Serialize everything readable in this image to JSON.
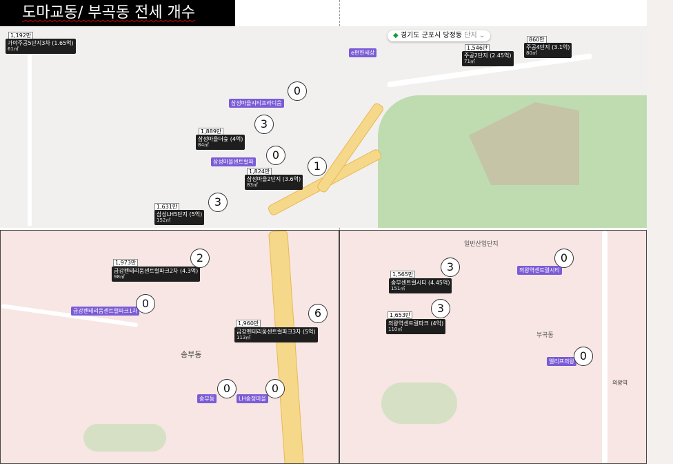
{
  "title": "도마교동/ 부곡동 전세 개수",
  "region_chip": {
    "icon": "location-pin-icon",
    "parts": [
      "경기도",
      "군포시",
      "당정동",
      "단지"
    ]
  },
  "panels": {
    "top": {
      "labels": [
        {
          "name": "가야주공5단지3차 (1.65억)",
          "size": "61㎡",
          "style": "dark",
          "price": "1,192만"
        },
        {
          "name": "e편한세상",
          "size": "",
          "style": "purple",
          "price": ""
        },
        {
          "name": "삼성마을시티프라디움",
          "size": "",
          "style": "purple",
          "price": ""
        },
        {
          "name": "삼성마을더숲 (4억)",
          "size": "84㎡",
          "style": "dark",
          "price": "1,889만"
        },
        {
          "name": "삼성마을센트럴파",
          "size": "",
          "style": "purple",
          "price": ""
        },
        {
          "name": "삼성마을2단지 (3.6억)",
          "size": "83㎡",
          "style": "dark",
          "price": "1,824만"
        },
        {
          "name": "삼성LH5단지 (5억)",
          "size": "152㎡",
          "style": "dark",
          "price": "1,631만"
        },
        {
          "name": "주공2단지 (2.45억)",
          "size": "71㎡",
          "style": "dark",
          "price": "1,546만"
        },
        {
          "name": "주공4단지 (3.1억)",
          "size": "80㎡",
          "style": "dark",
          "price": "860만"
        }
      ],
      "counts": [
        "0",
        "3",
        "0",
        "1",
        "3"
      ]
    },
    "bottom_left": {
      "labels": [
        {
          "name": "금강펜테리움센트럴파크2차 (4.3억)",
          "size": "98㎡",
          "style": "dark",
          "price": "1,973만"
        },
        {
          "name": "금강펜테리움센트럴파크1차",
          "size": "",
          "style": "purple",
          "price": ""
        },
        {
          "name": "금강펜테리움센트럴파크3차 (5억)",
          "size": "113㎡",
          "style": "dark",
          "price": "1,960만"
        },
        {
          "name": "송부동",
          "size": "",
          "style": "purple",
          "price": ""
        },
        {
          "name": "LH송정마을",
          "size": "",
          "style": "purple",
          "price": ""
        }
      ],
      "counts": [
        "2",
        "0",
        "6",
        "0",
        "0"
      ]
    },
    "bottom_right": {
      "labels": [
        {
          "name": "송부센트럴시티 (4.45억)",
          "size": "151㎡",
          "style": "dark",
          "price": "1,565만"
        },
        {
          "name": "의왕역센트럴시티",
          "size": "",
          "style": "purple",
          "price": ""
        },
        {
          "name": "의왕역센트럴파크 (4억)",
          "size": "110㎡",
          "style": "dark",
          "price": "1,653만"
        },
        {
          "name": "엘리프의왕",
          "size": "",
          "style": "purple",
          "price": ""
        }
      ],
      "counts": [
        "3",
        "0",
        "3",
        "0"
      ]
    }
  },
  "place_names": [
    "일반산업단지",
    "부곡동",
    "송부동",
    "의왕역"
  ]
}
